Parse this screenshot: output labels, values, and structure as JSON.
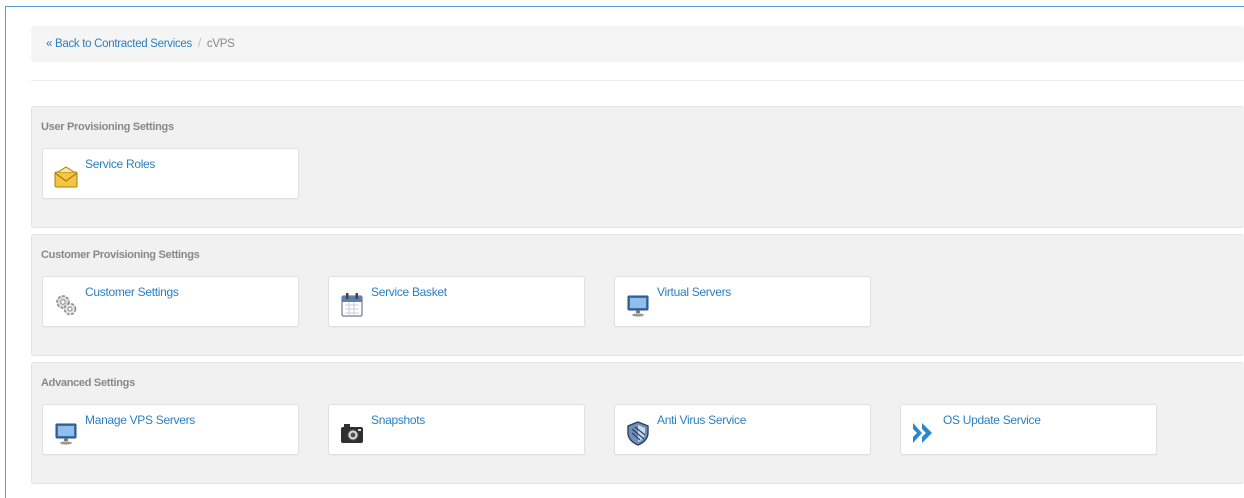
{
  "breadcrumb": {
    "back_link": "« Back to Contracted Services",
    "separator": "/",
    "current": "cVPS"
  },
  "sections": [
    {
      "title": "User Provisioning Settings",
      "tiles": [
        {
          "label": "Service Roles",
          "icon": "envelope-icon"
        }
      ]
    },
    {
      "title": "Customer Provisioning Settings",
      "tiles": [
        {
          "label": "Customer Settings",
          "icon": "gears-icon"
        },
        {
          "label": "Service Basket",
          "icon": "calendar-icon"
        },
        {
          "label": "Virtual Servers",
          "icon": "monitor-icon"
        }
      ]
    },
    {
      "title": "Advanced Settings",
      "tiles": [
        {
          "label": "Manage VPS Servers",
          "icon": "monitor-icon"
        },
        {
          "label": "Snapshots",
          "icon": "camera-icon"
        },
        {
          "label": "Anti Virus Service",
          "icon": "shield-icon"
        },
        {
          "label": "OS Update Service",
          "icon": "double-chevron-icon"
        }
      ]
    }
  ],
  "colors": {
    "link": "#2a7fc1",
    "section_bg": "#f1f1f1",
    "frame_border": "#5b9bd5"
  }
}
